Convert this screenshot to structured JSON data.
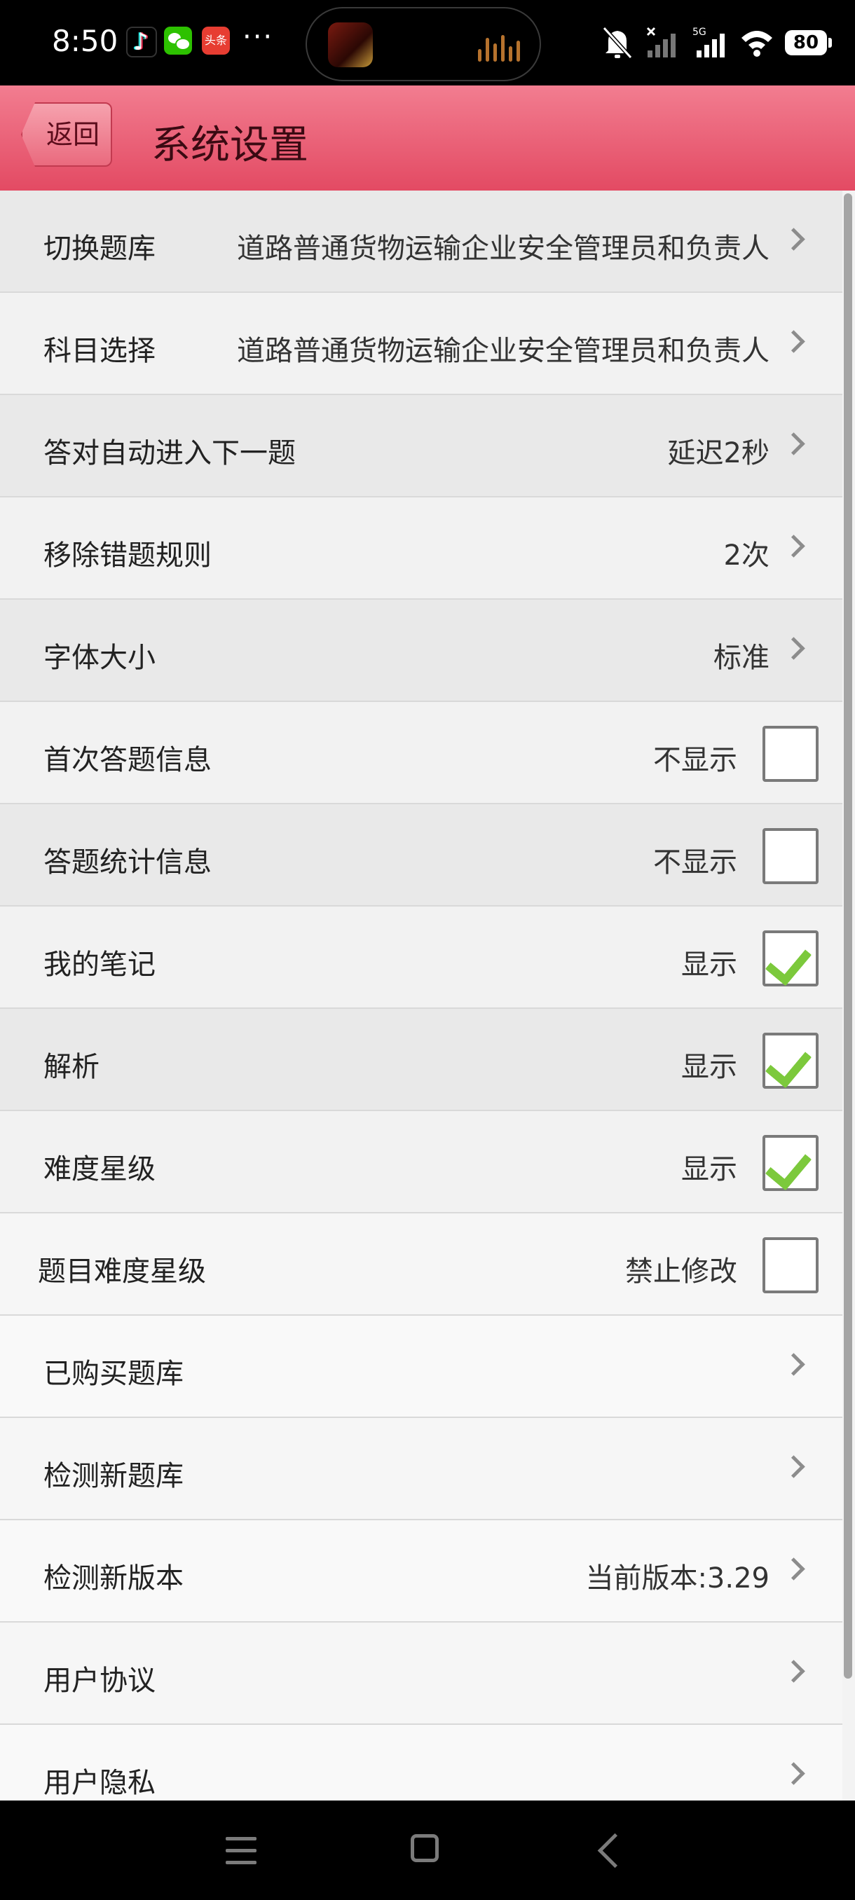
{
  "status_bar": {
    "time": "8:50",
    "apps": [
      "tiktok-icon",
      "wechat-icon",
      "toutiao-icon"
    ],
    "toutiao_label": "头条",
    "more": "···",
    "network": "5G",
    "battery": "80"
  },
  "header": {
    "back_label": "返回",
    "title": "系统设置"
  },
  "settings": [
    {
      "label": "切换题库",
      "value": "道路普通货物运输企业安全管理员和负责人",
      "control": "chevron"
    },
    {
      "label": "科目选择",
      "value": "道路普通货物运输企业安全管理员和负责人",
      "control": "chevron"
    },
    {
      "label": "答对自动进入下一题",
      "value": "延迟2秒",
      "control": "chevron"
    },
    {
      "label": "移除错题规则",
      "value": "2次",
      "control": "chevron"
    },
    {
      "label": "字体大小",
      "value": "标准",
      "control": "chevron"
    },
    {
      "label": "首次答题信息",
      "value": "不显示",
      "control": "checkbox",
      "checked": false
    },
    {
      "label": "答题统计信息",
      "value": "不显示",
      "control": "checkbox",
      "checked": false
    },
    {
      "label": "我的笔记",
      "value": "显示",
      "control": "checkbox",
      "checked": true
    },
    {
      "label": "解析",
      "value": "显示",
      "control": "checkbox",
      "checked": true
    },
    {
      "label": "难度星级",
      "value": "显示",
      "control": "checkbox",
      "checked": true
    },
    {
      "label": "题目难度星级",
      "value": "禁止修改",
      "control": "checkbox",
      "checked": false
    },
    {
      "label": "已购买题库",
      "value": "",
      "control": "chevron"
    },
    {
      "label": "检测新题库",
      "value": "",
      "control": "chevron"
    },
    {
      "label": "检测新版本",
      "value": "当前版本:3.29",
      "control": "chevron"
    },
    {
      "label": "用户协议",
      "value": "",
      "control": "chevron"
    },
    {
      "label": "用户隐私",
      "value": "",
      "control": "chevron"
    }
  ],
  "colors": {
    "header_top": "#f27d90",
    "header_bottom": "#e34a63",
    "check": "#7cc93c"
  }
}
